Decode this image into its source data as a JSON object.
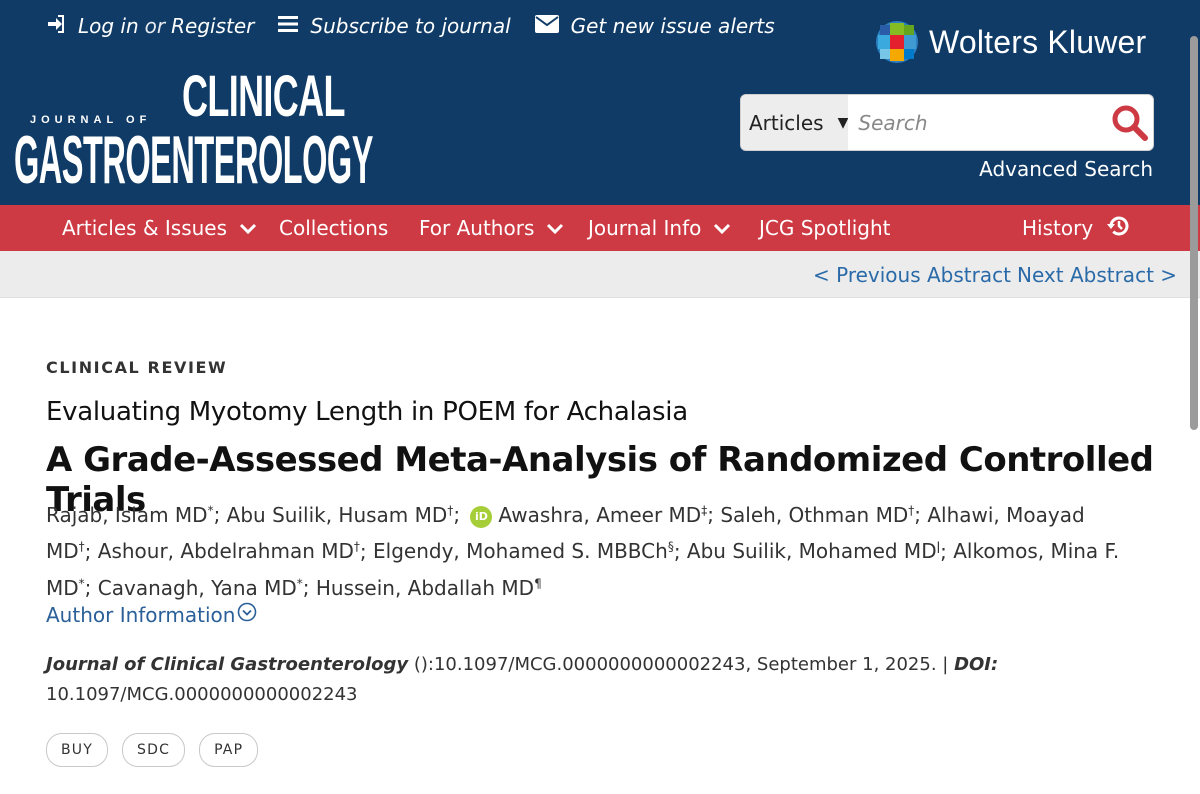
{
  "header": {
    "login_label": "Log in",
    "or_label": "or",
    "register_label": "Register",
    "subscribe_label": "Subscribe to journal",
    "alerts_label": "Get new issue alerts",
    "publisher": "Wolters Kluwer",
    "logo_journal_of": "JOURNAL OF",
    "logo_clinical": "CLINICAL",
    "logo_gastro": "GASTROENTEROLOGY",
    "search": {
      "scope": "Articles",
      "placeholder": "Search"
    },
    "advanced_search": "Advanced Search"
  },
  "nav": {
    "items": [
      {
        "label": "Articles & Issues",
        "dropdown": true
      },
      {
        "label": "Collections",
        "dropdown": false
      },
      {
        "label": "For Authors",
        "dropdown": true
      },
      {
        "label": "Journal Info",
        "dropdown": true
      },
      {
        "label": "JCG Spotlight",
        "dropdown": false
      }
    ],
    "history": "History"
  },
  "subnav": {
    "previous": "< Previous Abstract",
    "next": "Next Abstract >"
  },
  "article": {
    "section": "CLINICAL REVIEW",
    "subtitle": "Evaluating Myotomy Length in POEM for Achalasia",
    "title": "A Grade-Assessed Meta-Analysis of Randomized Controlled Trials",
    "authors": [
      {
        "name": "Rajab, Islam MD",
        "mark": "*"
      },
      {
        "name": "Abu Suilik, Husam MD",
        "mark": "†"
      },
      {
        "name": "Awashra, Ameer MD",
        "mark": "‡",
        "orcid": true
      },
      {
        "name": "Saleh, Othman MD",
        "mark": "†"
      },
      {
        "name": "Alhawi, Moayad MD",
        "mark": "†"
      },
      {
        "name": "Ashour, Abdelrahman MD",
        "mark": "†"
      },
      {
        "name": "Elgendy, Mohamed S. MBBCh",
        "mark": "§"
      },
      {
        "name": "Abu Suilik, Mohamed MD",
        "mark": "ǀ"
      },
      {
        "name": "Alkomos, Mina F. MD",
        "mark": "*"
      },
      {
        "name": "Cavanagh, Yana MD",
        "mark": "*"
      },
      {
        "name": "Hussein, Abdallah MD",
        "mark": "¶"
      }
    ],
    "author_info": "Author Information",
    "citation": {
      "journal": "Journal of Clinical Gastroenterology",
      "rest": " ():10.1097/MCG.0000000000002243, September 1, 2025. | ",
      "doi_label": "DOI:",
      "doi": " 10.1097/MCG.0000000000002243"
    },
    "tags": [
      "BUY",
      "SDC",
      "PAP"
    ]
  },
  "colors": {
    "header_bg": "#0f3b66",
    "nav_bg": "#cd3a43",
    "subbar_bg": "#ececec",
    "link": "#2a6aa8"
  }
}
